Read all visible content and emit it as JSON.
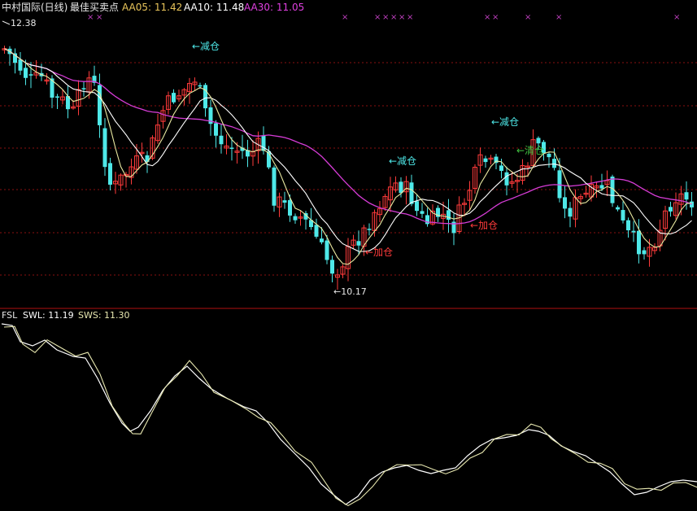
{
  "header": {
    "title": "中村国际(日线)",
    "indicator": "最佳买卖点",
    "ma": [
      {
        "label": "AA05: 11.42",
        "color": "#e8c45a"
      },
      {
        "label": "AA10: 11.48",
        "color": "#ffffff"
      },
      {
        "label": "AA30: 11.05",
        "color": "#e040e0"
      }
    ]
  },
  "annotations": {
    "high": "12.38",
    "low": "←10.17",
    "reduce_1": "←减仓",
    "reduce_2": "←减仓",
    "reduce_3": "←减仓",
    "add_1": "←加仓",
    "add_2": "←加仓",
    "clear": "←清仓"
  },
  "lower_panel": {
    "fsl_label": "FSL",
    "swl_label": "SWL: 11.19",
    "sws_label": "SWS: 11.30"
  },
  "colors": {
    "up": "#ff3b3b",
    "down": "#4ee8e8",
    "aa05": "#e8e8a0",
    "aa10": "#ffffff",
    "aa30": "#d63cd6",
    "marker": "#c040c0",
    "divider": "#b01010",
    "grid": "#8a1010"
  },
  "chart_data": {
    "type": "candlestick",
    "price_range_approx": [
      10.17,
      12.38
    ],
    "high_label": 12.38,
    "low_label": 10.17,
    "moving_averages": {
      "AA05": 11.42,
      "AA10": 11.48,
      "AA30": 11.05
    },
    "lower_indicator": {
      "name": "FSL",
      "SWL": 11.19,
      "SWS": 11.3
    }
  }
}
